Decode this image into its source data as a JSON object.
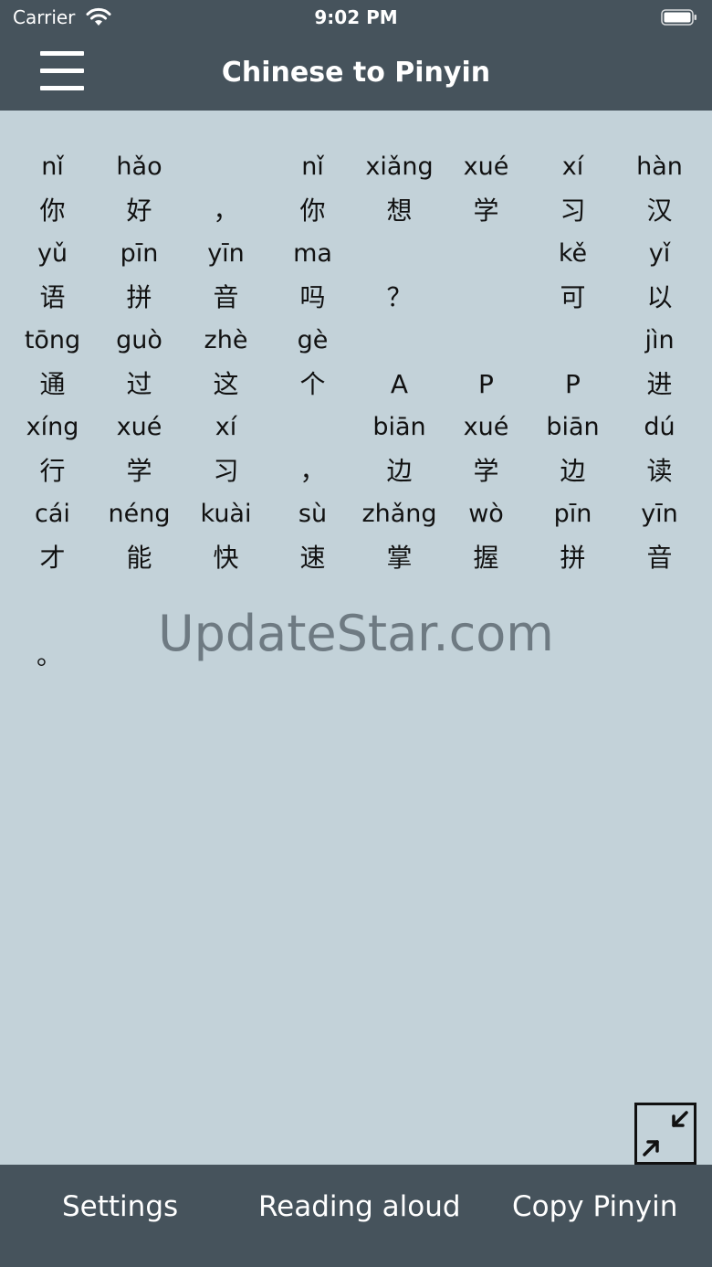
{
  "status_bar": {
    "carrier": "Carrier",
    "time": "9:02 PM",
    "icons": [
      "wifi-icon",
      "battery-icon"
    ]
  },
  "nav": {
    "menu_icon": "hamburger-menu-icon",
    "title": "Chinese to Pinyin"
  },
  "rows": [
    {
      "pinyin": [
        "nǐ",
        "hǎo",
        "",
        "nǐ",
        "xiǎng",
        "xué",
        "xí",
        "hàn"
      ],
      "hanzi": [
        "你",
        "好",
        "，",
        "你",
        "想",
        "学",
        "习",
        "汉"
      ]
    },
    {
      "pinyin": [
        "yǔ",
        "pīn",
        "yīn",
        "ma",
        "",
        "",
        "kě",
        "yǐ"
      ],
      "hanzi": [
        "语",
        "拼",
        "音",
        "吗",
        "？",
        "",
        "可",
        "以"
      ]
    },
    {
      "pinyin": [
        "tōng",
        "guò",
        "zhè",
        "gè",
        "",
        "",
        "",
        "jìn"
      ],
      "hanzi": [
        "通",
        "过",
        "这",
        "个",
        "A",
        "P",
        "P",
        "进"
      ]
    },
    {
      "pinyin": [
        "xíng",
        "xué",
        "xí",
        "",
        "biān",
        "xué",
        "biān",
        "dú"
      ],
      "hanzi": [
        "行",
        "学",
        "习",
        "，",
        "边",
        "学",
        "边",
        "读"
      ]
    },
    {
      "pinyin": [
        "cái",
        "néng",
        "kuài",
        "sù",
        "zhǎng",
        "wò",
        "pīn",
        "yīn"
      ],
      "hanzi": [
        "才",
        "能",
        "快",
        "速",
        "掌",
        "握",
        "拼",
        "音"
      ]
    }
  ],
  "trailing_punct": "。",
  "watermark": "UpdateStar.com",
  "collapse_icon": "collapse-arrows-icon",
  "bottom_tabs": {
    "settings": "Settings",
    "reading_aloud": "Reading aloud",
    "copy_pinyin": "Copy Pinyin"
  },
  "colors": {
    "bar": "#46535c",
    "background": "#c3d2d9",
    "watermark": "#6e7a82"
  }
}
